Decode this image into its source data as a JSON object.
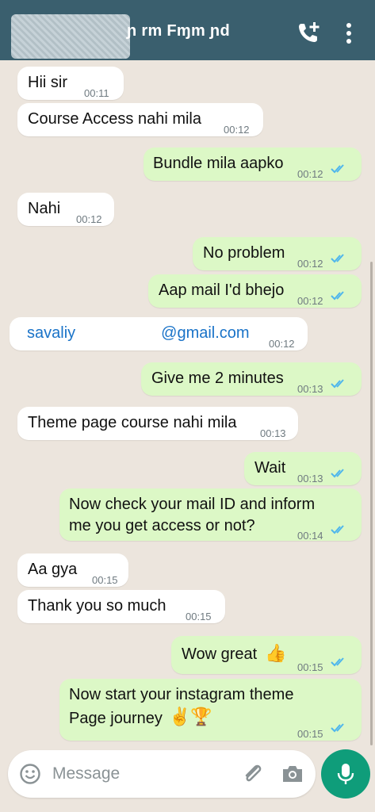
{
  "header": {
    "contact_name": "ɲ rm Fɱm ɲd"
  },
  "messages": [
    {
      "dir": "in",
      "text": "Hii sir",
      "time": "00:11"
    },
    {
      "dir": "in",
      "text": "Course Access nahi mila",
      "time": "00:12"
    },
    {
      "dir": "out",
      "text": "Bundle mila aapko",
      "time": "00:12"
    },
    {
      "dir": "in",
      "text": "Nahi",
      "time": "00:12"
    },
    {
      "dir": "out",
      "text": "No problem",
      "time": "00:12"
    },
    {
      "dir": "out",
      "text": "Aap mail I'd bhejo",
      "time": "00:12"
    },
    {
      "dir": "in",
      "text_start": "savaliy",
      "text_end": "@gmail.com",
      "time": "00:12"
    },
    {
      "dir": "out",
      "text": "Give me 2 minutes",
      "time": "00:13"
    },
    {
      "dir": "in",
      "text": "Theme page course nahi mila",
      "time": "00:13"
    },
    {
      "dir": "out",
      "text": "Wait",
      "time": "00:13"
    },
    {
      "dir": "out",
      "line1": "Now check your mail ID and inform",
      "line2": "me you get access or not?",
      "time": "00:14"
    },
    {
      "dir": "in",
      "text": "Aa gya",
      "time": "00:15"
    },
    {
      "dir": "in",
      "text": "Thank you so much",
      "time": "00:15"
    },
    {
      "dir": "out",
      "text": "Wow great",
      "emoji": "👍",
      "time": "00:15"
    },
    {
      "dir": "out",
      "line1": "Now start your instagram theme",
      "line2": "Page journey",
      "emoji": "✌️🏆",
      "time": "00:15"
    }
  ],
  "composer": {
    "placeholder": "Message"
  },
  "colors": {
    "header": "#3a5f6e",
    "background": "#ece5dd",
    "outgoing": "#dcf8c6",
    "incoming": "#ffffff",
    "ticks": "#4fb6ec",
    "mic": "#0f9d7a"
  },
  "icons": [
    "call-add-icon",
    "more-vert-icon",
    "emoji-icon",
    "attach-icon",
    "camera-icon",
    "mic-icon",
    "double-check-icon"
  ]
}
